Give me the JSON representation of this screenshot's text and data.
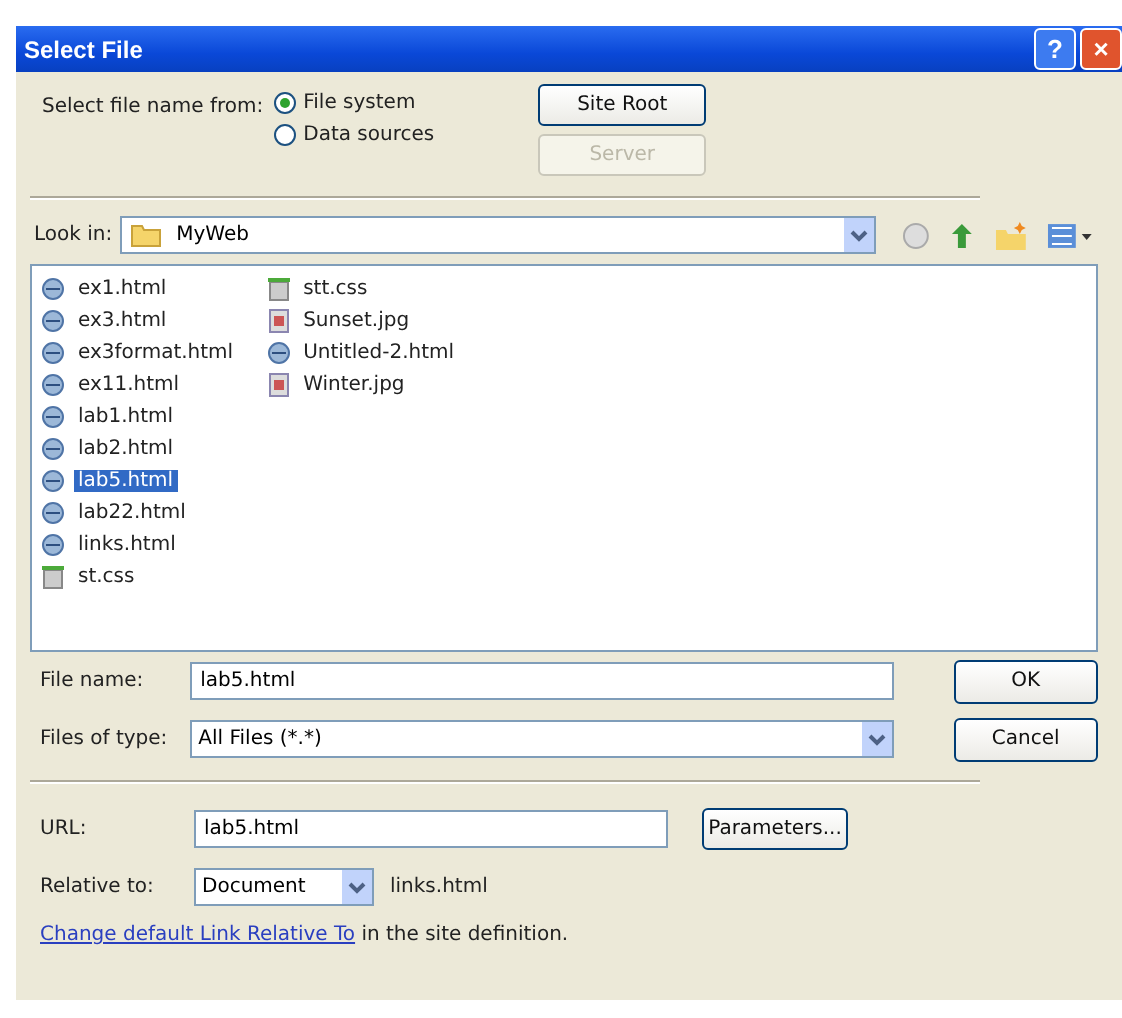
{
  "window": {
    "title": "Select File",
    "help": "?",
    "close": "×"
  },
  "source": {
    "label": "Select file name from:",
    "options": [
      {
        "label": "File system",
        "selected": true
      },
      {
        "label": "Data sources",
        "selected": false
      }
    ]
  },
  "site_root_button": {
    "label": "Site Root",
    "disabled": false
  },
  "server_button": {
    "label": "Server",
    "disabled": true
  },
  "look_in": {
    "label": "Look in:",
    "value": "MyWeb"
  },
  "files": [
    {
      "name": "ex1.html",
      "kind": "html",
      "selected": false
    },
    {
      "name": "ex3.html",
      "kind": "html",
      "selected": false
    },
    {
      "name": "ex3format.html",
      "kind": "html",
      "selected": false
    },
    {
      "name": "ex11.html",
      "kind": "html",
      "selected": false
    },
    {
      "name": "lab1.html",
      "kind": "html",
      "selected": false
    },
    {
      "name": "lab2.html",
      "kind": "html",
      "selected": false
    },
    {
      "name": "lab5.html",
      "kind": "html",
      "selected": true
    },
    {
      "name": "lab22.html",
      "kind": "html",
      "selected": false
    },
    {
      "name": "links.html",
      "kind": "html",
      "selected": false
    },
    {
      "name": "st.css",
      "kind": "css",
      "selected": false
    },
    {
      "name": "stt.css",
      "kind": "css",
      "selected": false
    },
    {
      "name": "Sunset.jpg",
      "kind": "jpg",
      "selected": false
    },
    {
      "name": "Untitled-2.html",
      "kind": "html",
      "selected": false
    },
    {
      "name": "Winter.jpg",
      "kind": "jpg",
      "selected": false
    }
  ],
  "file_name": {
    "label": "File name:",
    "value": "lab5.html"
  },
  "files_of_type": {
    "label": "Files of type:",
    "value": "All Files (*.*)"
  },
  "ok_button": {
    "label": "OK"
  },
  "cancel_button": {
    "label": "Cancel"
  },
  "url": {
    "label": "URL:",
    "value": "lab5.html"
  },
  "parameters_button": {
    "label": "Parameters..."
  },
  "relative_to": {
    "label": "Relative to:",
    "value": "Document",
    "file": "links.html"
  },
  "footer": {
    "link": "Change default Link Relative To",
    "text": " in the site definition."
  }
}
